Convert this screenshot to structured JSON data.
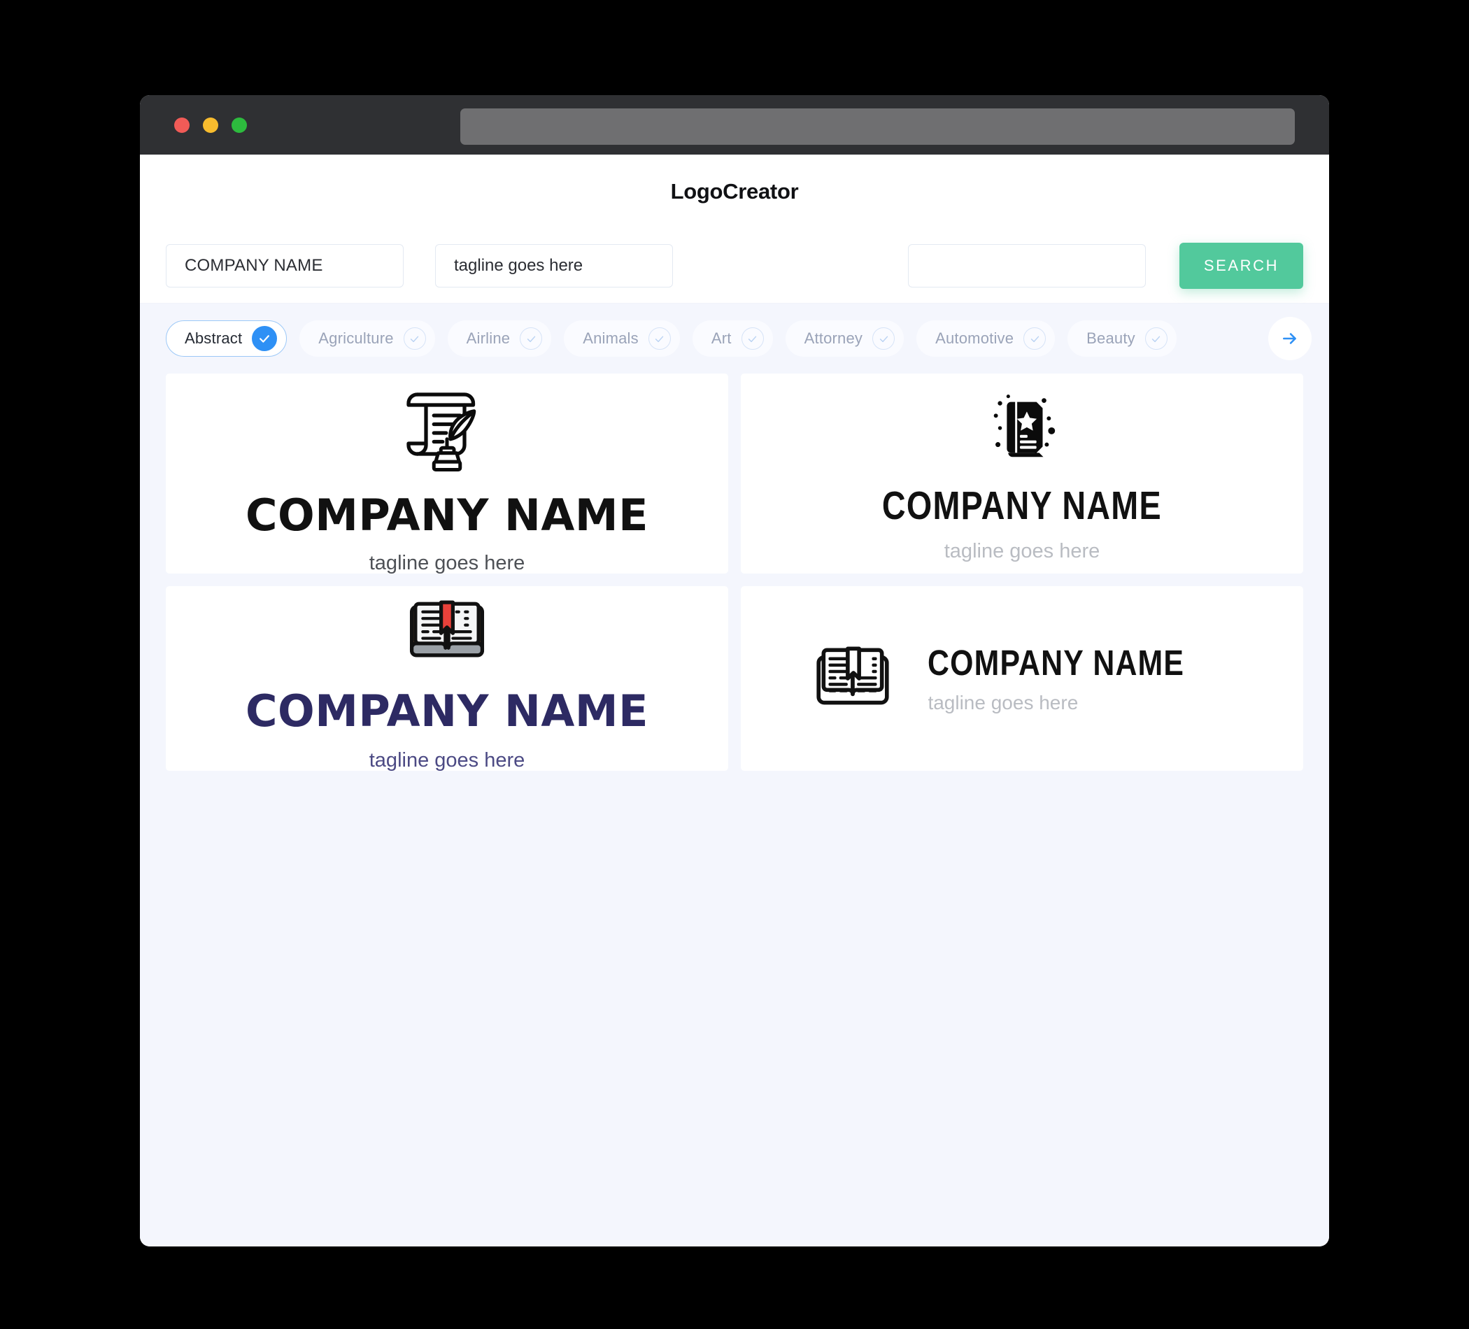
{
  "window": {
    "traffic_lights": [
      {
        "name": "close",
        "color": "#f15b57"
      },
      {
        "name": "minimize",
        "color": "#f8bc2e"
      },
      {
        "name": "maximize",
        "color": "#2dbb3e"
      }
    ],
    "url_value": ""
  },
  "header": {
    "app_title": "LogoCreator"
  },
  "search": {
    "company_value": "COMPANY NAME",
    "company_placeholder": "COMPANY NAME",
    "tagline_value": "tagline goes here",
    "tagline_placeholder": "tagline goes here",
    "third_value": "",
    "third_placeholder": "",
    "search_label": "SEARCH",
    "accent_color": "#52c99c"
  },
  "categories": {
    "accent_color": "#2e90f5",
    "next_icon": "arrow-right-icon",
    "items": [
      {
        "label": "Abstract",
        "selected": true
      },
      {
        "label": "Agriculture",
        "selected": false
      },
      {
        "label": "Airline",
        "selected": false
      },
      {
        "label": "Animals",
        "selected": false
      },
      {
        "label": "Art",
        "selected": false
      },
      {
        "label": "Attorney",
        "selected": false
      },
      {
        "label": "Automotive",
        "selected": false
      },
      {
        "label": "Beauty",
        "selected": false
      }
    ]
  },
  "results": {
    "cards": [
      {
        "icon": "scroll-quill-inkwell-icon",
        "layout": "stacked",
        "company_name": "COMPANY NAME",
        "tagline": "tagline goes here",
        "name_color": "#111111",
        "tagline_color": "#4e5156"
      },
      {
        "icon": "book-star-sparkle-icon",
        "layout": "stacked",
        "company_name": "COMPANY NAME",
        "tagline": "tagline goes here",
        "name_color": "#111111",
        "tagline_color": "#b9bcc2"
      },
      {
        "icon": "open-book-bookmark-color-icon",
        "layout": "stacked",
        "company_name": "COMPANY NAME",
        "tagline": "tagline goes here",
        "name_color": "#2d2a63",
        "tagline_color": "#4c4a84"
      },
      {
        "icon": "open-book-bookmark-outline-icon",
        "layout": "horizontal",
        "company_name": "COMPANY NAME",
        "tagline": "tagline goes here",
        "name_color": "#111111",
        "tagline_color": "#b9bcc2"
      }
    ]
  }
}
